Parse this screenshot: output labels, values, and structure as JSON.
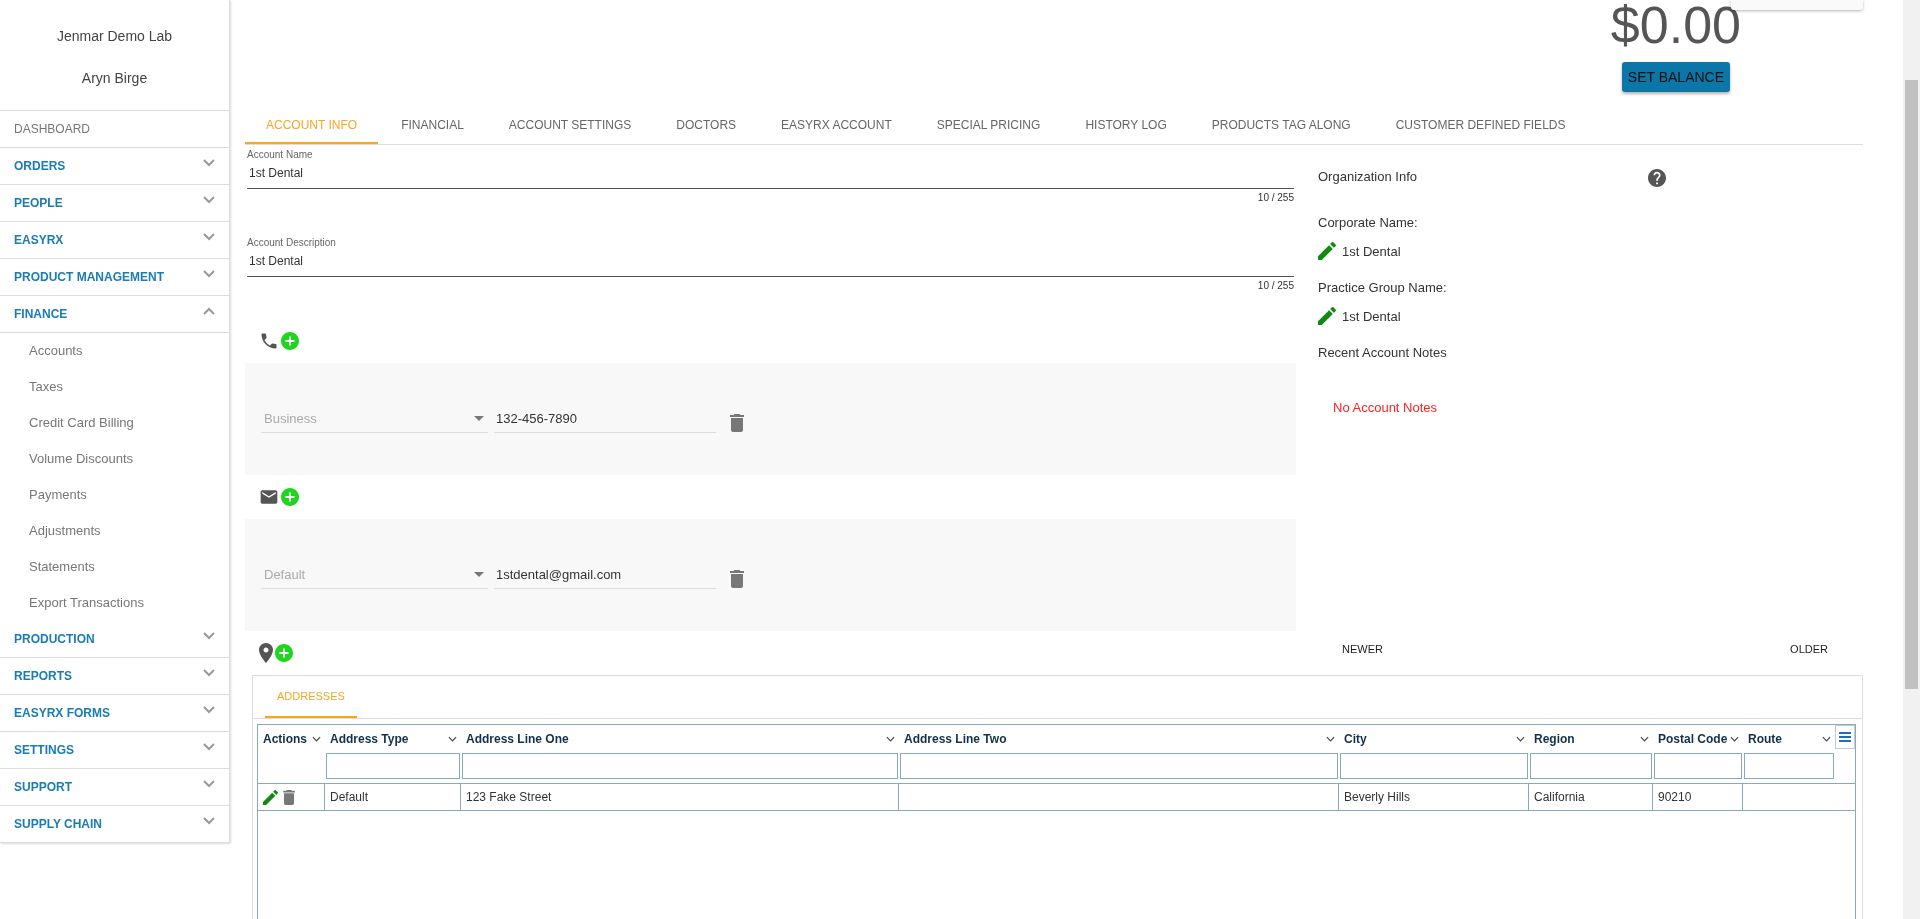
{
  "sidebar": {
    "lab_name": "Jenmar Demo Lab",
    "user_name": "Aryn Birge",
    "items": [
      {
        "kind": "link",
        "label": "DASHBOARD"
      },
      {
        "kind": "section",
        "label": "ORDERS",
        "expanded": false
      },
      {
        "kind": "section",
        "label": "PEOPLE",
        "expanded": false
      },
      {
        "kind": "section",
        "label": "EASYRX",
        "expanded": false
      },
      {
        "kind": "section",
        "label": "PRODUCT MANAGEMENT",
        "expanded": false
      },
      {
        "kind": "section",
        "label": "FINANCE",
        "expanded": true,
        "children": [
          {
            "label": "Accounts"
          },
          {
            "label": "Taxes"
          },
          {
            "label": "Credit Card Billing"
          },
          {
            "label": "Volume Discounts"
          },
          {
            "label": "Payments"
          },
          {
            "label": "Adjustments"
          },
          {
            "label": "Statements"
          },
          {
            "label": "Export Transactions"
          }
        ]
      },
      {
        "kind": "section",
        "label": "PRODUCTION",
        "expanded": false
      },
      {
        "kind": "section",
        "label": "REPORTS",
        "expanded": false
      },
      {
        "kind": "section",
        "label": "EASYRX FORMS",
        "expanded": false
      },
      {
        "kind": "section",
        "label": "SETTINGS",
        "expanded": false
      },
      {
        "kind": "section",
        "label": "SUPPORT",
        "expanded": false
      },
      {
        "kind": "section",
        "label": "SUPPLY CHAIN",
        "expanded": false
      }
    ]
  },
  "header": {
    "balance": "$0.00",
    "set_balance_button": "SET BALANCE"
  },
  "tabs": [
    {
      "label": "ACCOUNT INFO",
      "selected": true
    },
    {
      "label": "FINANCIAL",
      "selected": false
    },
    {
      "label": "ACCOUNT SETTINGS",
      "selected": false
    },
    {
      "label": "DOCTORS",
      "selected": false
    },
    {
      "label": "EASYRX ACCOUNT",
      "selected": false
    },
    {
      "label": "SPECIAL PRICING",
      "selected": false
    },
    {
      "label": "HISTORY LOG",
      "selected": false
    },
    {
      "label": "PRODUCTS TAG ALONG",
      "selected": false
    },
    {
      "label": "CUSTOMER DEFINED FIELDS",
      "selected": false
    }
  ],
  "fields": [
    {
      "label": "Account Name",
      "value": "1st Dental",
      "counter": "10 / 255"
    },
    {
      "label": "Account Description",
      "value": "1st Dental",
      "counter": "10 / 255"
    }
  ],
  "contacts": [
    {
      "kind": "phone",
      "type": "Business",
      "value": "132-456-7890"
    },
    {
      "kind": "email",
      "type": "Default",
      "value": "1stdental@gmail.com"
    }
  ],
  "organization": {
    "title": "Organization Info",
    "corporate_label": "Corporate Name:",
    "corporate_name": "1st Dental",
    "practice_label": "Practice Group Name:",
    "practice_name": "1st Dental",
    "notes_title": "Recent Account Notes",
    "notes_empty": "No Account Notes",
    "newer": "NEWER",
    "older": "OLDER"
  },
  "addresses": {
    "tab": "ADDRESSES",
    "columns": [
      {
        "kind": "actions",
        "label": "Actions"
      },
      {
        "kind": "text",
        "label": "Address Type"
      },
      {
        "kind": "text",
        "label": "Address Line One"
      },
      {
        "kind": "text",
        "label": "Address Line Two"
      },
      {
        "kind": "text",
        "label": "City"
      },
      {
        "kind": "text",
        "label": "Region"
      },
      {
        "kind": "text",
        "label": "Postal Code"
      },
      {
        "kind": "text",
        "label": "Route"
      }
    ],
    "rows": [
      {
        "cells": [
          "",
          "Default",
          "123 Fake Street",
          "",
          "Beverly Hills",
          "California",
          "90210",
          ""
        ]
      }
    ]
  }
}
